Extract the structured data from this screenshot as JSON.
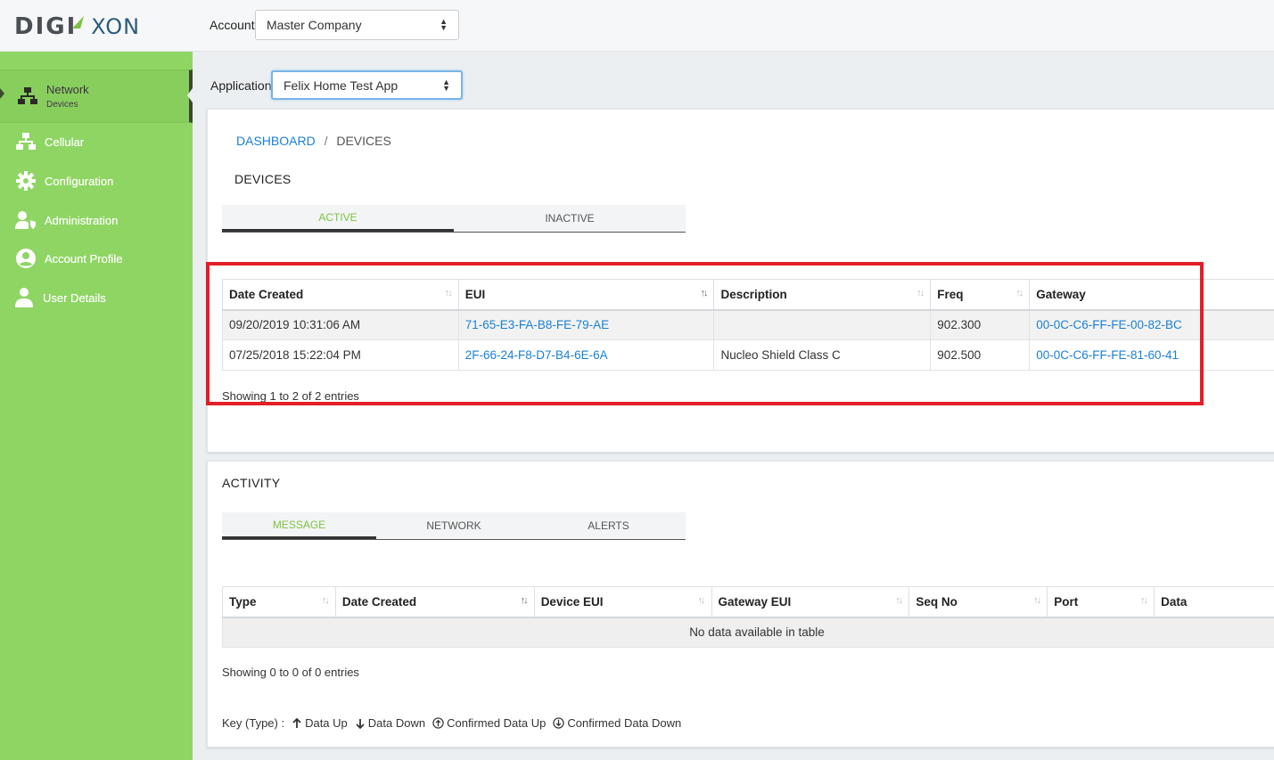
{
  "brand": {
    "part1": "DIGI",
    "part2": "XON"
  },
  "topbar": {
    "account_label": "Account",
    "account_selected": "Master Company"
  },
  "sidebar": {
    "items": [
      {
        "label": "Network",
        "sublabel": "Devices",
        "icon": "network-icon",
        "active": true
      },
      {
        "label": "Cellular",
        "icon": "network-icon"
      },
      {
        "label": "Configuration",
        "icon": "gear-icon"
      },
      {
        "label": "Administration",
        "icon": "user-shield-icon"
      },
      {
        "label": "Account Profile",
        "icon": "user-circle-icon"
      },
      {
        "label": "User Details",
        "icon": "user-icon"
      }
    ]
  },
  "application": {
    "label": "Application",
    "selected": "Felix Home Test App"
  },
  "breadcrumb": {
    "root": "DASHBOARD",
    "sep": "/",
    "current": "DEVICES"
  },
  "devices": {
    "title": "DEVICES",
    "tabs": [
      "ACTIVE",
      "INACTIVE"
    ],
    "columns": [
      "Date Created",
      "EUI",
      "Description",
      "Freq",
      "Gateway"
    ],
    "rows": [
      {
        "date": "09/20/2019 10:31:06 AM",
        "eui": "71-65-E3-FA-B8-FE-79-AE",
        "description": "",
        "freq": "902.300",
        "gateway": "00-0C-C6-FF-FE-00-82-BC"
      },
      {
        "date": "07/25/2018 15:22:04 PM",
        "eui": "2F-66-24-F8-D7-B4-6E-6A",
        "description": "Nucleo Shield Class C",
        "freq": "902.500",
        "gateway": "00-0C-C6-FF-FE-81-60-41"
      }
    ],
    "info": "Showing 1 to 2 of 2 entries"
  },
  "activity": {
    "title": "ACTIVITY",
    "tabs": [
      "MESSAGE",
      "NETWORK",
      "ALERTS"
    ],
    "columns": [
      "Type",
      "Date Created",
      "Device EUI",
      "Gateway EUI",
      "Seq No",
      "Port",
      "Data"
    ],
    "empty": "No data available in table",
    "info": "Showing 0 to 0 of 0 entries",
    "key_label": "Key (Type) :",
    "key_items": [
      "Data Up",
      "Data Down",
      "Confirmed Data Up",
      "Confirmed Data Down"
    ]
  },
  "colors": {
    "sidebar": "#8fd564",
    "link": "#1a7fd4",
    "active_tab": "#7dc242",
    "highlight": "#e41e26"
  }
}
